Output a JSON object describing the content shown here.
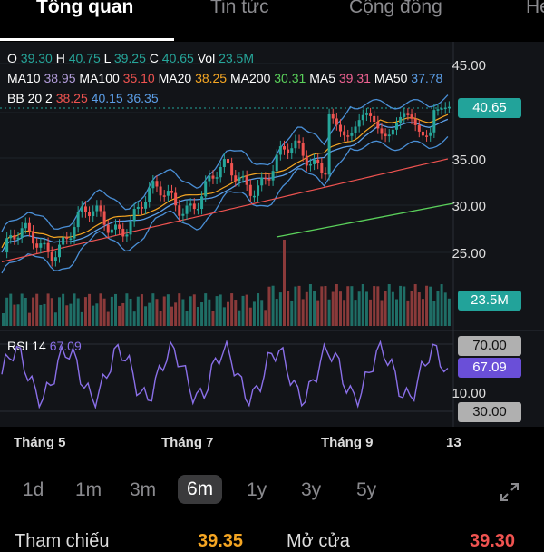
{
  "tabs": [
    {
      "label": "Tổng quan",
      "active": true
    },
    {
      "label": "Tin tức",
      "active": false
    },
    {
      "label": "Cộng đồng",
      "active": false
    },
    {
      "label": "He",
      "active": false
    }
  ],
  "ohlc": {
    "o_label": "O",
    "o": "39.30",
    "h_label": "H",
    "h": "40.75",
    "l_label": "L",
    "l": "39.25",
    "c_label": "C",
    "c": "40.65",
    "vol_label": "Vol",
    "vol": "23.5M"
  },
  "ma": {
    "ma10_label": "MA10",
    "ma10": "38.95",
    "ma100_label": "MA100",
    "ma100": "35.10",
    "ma20_label": "MA20",
    "ma20": "38.25",
    "ma200_label": "MA200",
    "ma200": "30.31",
    "ma5_label": "MA5",
    "ma5": "39.31",
    "ma50_label": "MA50",
    "ma50": "37.78"
  },
  "bb": {
    "label": "BB 20 2",
    "upper": "38.25",
    "mid": "40.15",
    "lower": "36.35"
  },
  "price_axis": [
    "45.00",
    "35.00",
    "30.00",
    "25.00"
  ],
  "price_badge": "40.65",
  "volume_badge": "23.5M",
  "rsi": {
    "label": "RSI 14",
    "value": "67.09",
    "upper": "70.00",
    "lower": "30.00",
    "axis_10": "10.00"
  },
  "months": [
    "Tháng 5",
    "Tháng 7",
    "Tháng 9",
    "13"
  ],
  "ranges": [
    {
      "label": "1d",
      "active": false
    },
    {
      "label": "1m",
      "active": false
    },
    {
      "label": "3m",
      "active": false
    },
    {
      "label": "6m",
      "active": true
    },
    {
      "label": "1y",
      "active": false
    },
    {
      "label": "3y",
      "active": false
    },
    {
      "label": "5y",
      "active": false
    }
  ],
  "bottom": {
    "ref_label": "Tham chiếu",
    "ref_value": "39.35",
    "open_label": "Mở cửa",
    "open_value": "39.30"
  },
  "colors": {
    "up": "#26a69a",
    "down": "#ef5350",
    "ma10": "#b39ddb",
    "ma100": "#ef5350",
    "ma20": "#f5a623",
    "ma200": "#5bd25b",
    "ma5": "#f06292",
    "ma50": "#5c9fe8",
    "rsi": "#8a6fe8",
    "accent": "#22a39a"
  }
}
